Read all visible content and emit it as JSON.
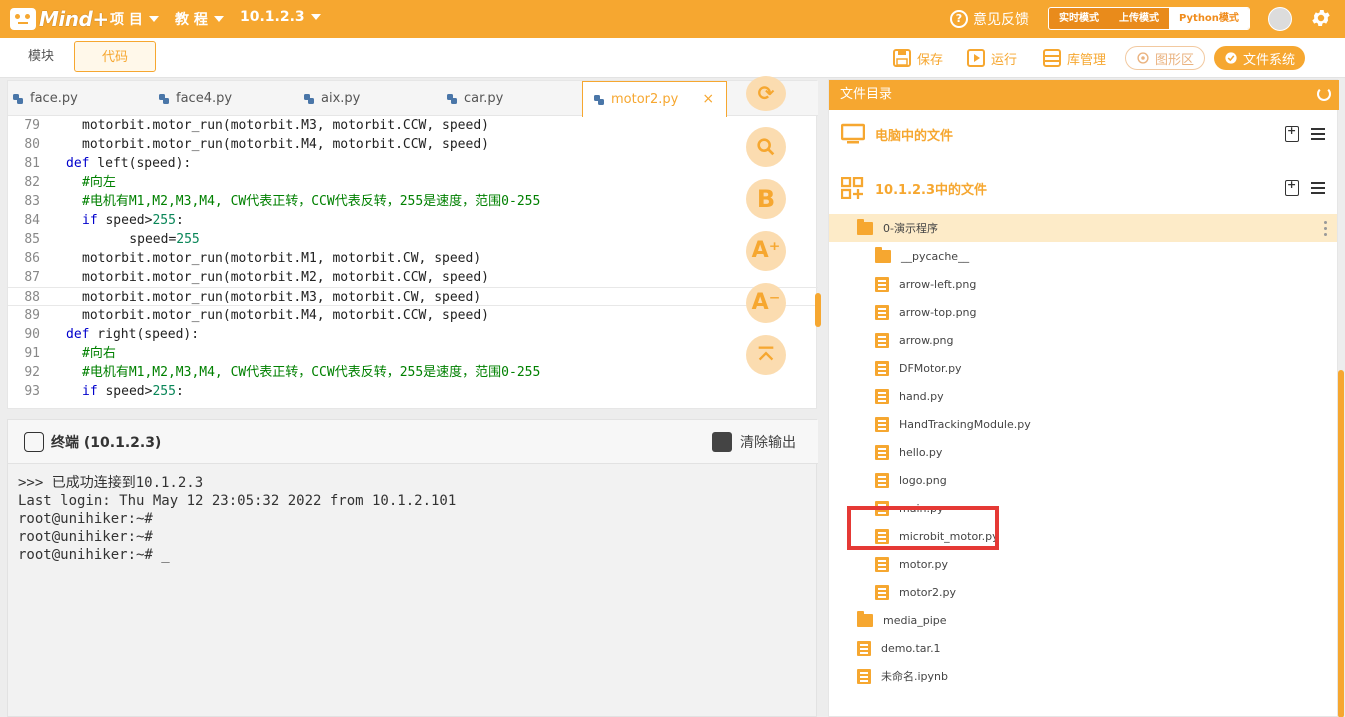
{
  "app": {
    "brand": "Mind+",
    "menu": [
      {
        "label": "项 目"
      },
      {
        "label": "教 程"
      },
      {
        "label": "10.1.2.3"
      }
    ],
    "feedback": "意见反馈",
    "modes": [
      "实时模式",
      "上传模式",
      "Python模式"
    ],
    "active_mode": "Python模式"
  },
  "subbar": {
    "tabs": [
      "模块",
      "代码"
    ],
    "active_tab": "代码",
    "tools": {
      "save": "保存",
      "run": "运行",
      "library": "库管理",
      "graphics": "图形区",
      "filesystem": "文件系统"
    }
  },
  "editor": {
    "tabs": [
      "face.py",
      "face4.py",
      "aix.py",
      "car.py",
      "motor2.py"
    ],
    "active_tab": "motor2.py",
    "close_glyph": "×",
    "lines": [
      {
        "n": "79",
        "code": "motorbit.motor_run(motorbit.M3, motorbit.CCW, speed)"
      },
      {
        "n": "80",
        "code": "motorbit.motor_run(motorbit.M4, motorbit.CCW, speed)"
      },
      {
        "n": "81",
        "kw": "def",
        "code": " left(speed):"
      },
      {
        "n": "82",
        "comment": "#向左"
      },
      {
        "n": "83",
        "comment": "#电机有M1,M2,M3,M4, CW代表正转，CCW代表反转，255是速度，范围0-255"
      },
      {
        "n": "84",
        "kw": "if",
        "code": " speed>",
        "num": "255",
        "tail": ":"
      },
      {
        "n": "85",
        "code": "    speed=",
        "num": "255"
      },
      {
        "n": "86",
        "code": "motorbit.motor_run(motorbit.M1, motorbit.CW, speed)"
      },
      {
        "n": "87",
        "code": "motorbit.motor_run(motorbit.M2, motorbit.CCW, speed)"
      },
      {
        "n": "88",
        "code": "motorbit.motor_run(motorbit.M3, motorbit.CW, speed)"
      },
      {
        "n": "89",
        "code": "motorbit.motor_run(motorbit.M4, motorbit.CCW, speed)"
      },
      {
        "n": "90",
        "kw": "def",
        "code": " right(speed):"
      },
      {
        "n": "91",
        "comment": "#向右"
      },
      {
        "n": "92",
        "comment": "#电机有M1,M2,M3,M4, CW代表正转，CCW代表反转，255是速度，范围0-255"
      },
      {
        "n": "93",
        "kw": "if",
        "code": " speed>",
        "num": "255",
        "tail": ":"
      }
    ],
    "current_line": "88"
  },
  "terminal": {
    "title": "终端 (10.1.2.3)",
    "clear": "清除输出",
    "lines": [
      ">>> 已成功连接到10.1.2.3",
      "Last login: Thu May 12 23:05:32 2022 from 10.1.2.101",
      "root@unihiker:~#",
      "root@unihiker:~#",
      "root@unihiker:~# _"
    ]
  },
  "files": {
    "header": "文件目录",
    "section_pc": "电脑中的文件",
    "section_device": "10.1.2.3中的文件",
    "tree": [
      {
        "name": "0-演示程序",
        "type": "folder",
        "level": 0,
        "selected": true
      },
      {
        "name": "__pycache__",
        "type": "folder",
        "level": 1
      },
      {
        "name": "arrow-left.png",
        "type": "file",
        "level": 1
      },
      {
        "name": "arrow-top.png",
        "type": "file",
        "level": 1
      },
      {
        "name": "arrow.png",
        "type": "file",
        "level": 1
      },
      {
        "name": "DFMotor.py",
        "type": "file",
        "level": 1
      },
      {
        "name": "hand.py",
        "type": "file",
        "level": 1
      },
      {
        "name": "HandTrackingModule.py",
        "type": "file",
        "level": 1
      },
      {
        "name": "hello.py",
        "type": "file",
        "level": 1
      },
      {
        "name": "logo.png",
        "type": "file",
        "level": 1
      },
      {
        "name": "main.py",
        "type": "file",
        "level": 1
      },
      {
        "name": "microbit_motor.py",
        "type": "file",
        "level": 1,
        "highlighted": true
      },
      {
        "name": "motor.py",
        "type": "file",
        "level": 1
      },
      {
        "name": "motor2.py",
        "type": "file",
        "level": 1
      },
      {
        "name": "media_pipe",
        "type": "folder",
        "level": 0
      },
      {
        "name": "demo.tar.1",
        "type": "file",
        "level": 0
      },
      {
        "name": "未命名.ipynb",
        "type": "file",
        "level": 0
      }
    ]
  },
  "colors": {
    "brand_orange": "#f6a730",
    "highlight_red": "#e53935"
  }
}
